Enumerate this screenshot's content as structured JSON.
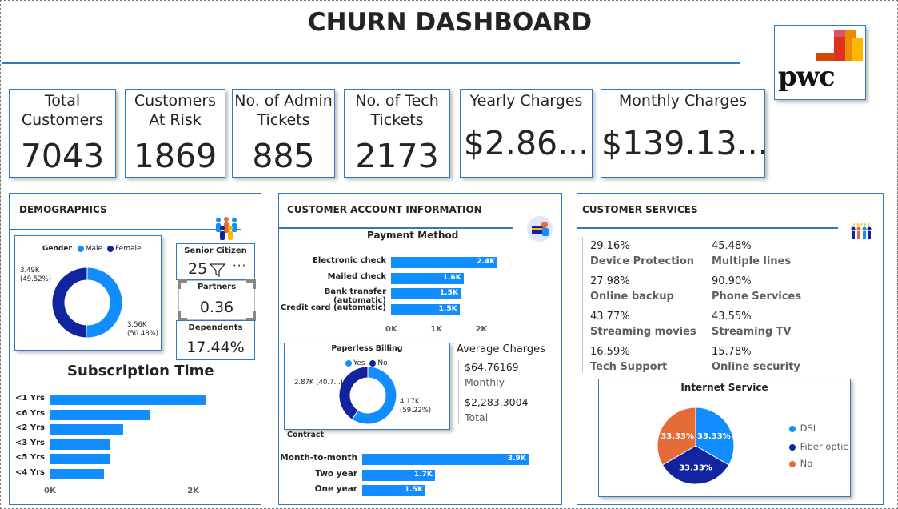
{
  "title": "CHURN DASHBOARD",
  "logo": {
    "text": "pwc"
  },
  "kpis": [
    {
      "label": "Total Customers",
      "value": "7043"
    },
    {
      "label": "Customers At Risk",
      "value": "1869"
    },
    {
      "label": "No. of Admin Tickets",
      "value": "885"
    },
    {
      "label": "No. of Tech Tickets",
      "value": "2173"
    },
    {
      "label": "Yearly Charges",
      "value": "$2.86..."
    },
    {
      "label": "Monthly Charges",
      "value": "$139.13..."
    }
  ],
  "demographics": {
    "header": "DEMOGRAPHICS",
    "icon": "people-group-icon",
    "gender_legend_title": "Gender",
    "senior_label": "Senior Citizen",
    "senior_value": "25",
    "partners_label": "Partners",
    "partners_value": "0.36",
    "dependents_label": "Dependents",
    "dependents_value": "17.44%",
    "subscription_title": "Subscription Time"
  },
  "account": {
    "header": "CUSTOMER ACCOUNT INFORMATION",
    "icon": "account-card-icon",
    "payment_title": "Payment Method",
    "paperless_title": "Paperless Billing",
    "avg_title": "Average Charges",
    "avg_monthly_value": "$64.76169",
    "avg_monthly_label": "Monthly",
    "avg_total_value": "$2,283.3004",
    "avg_total_label": "Total",
    "contract_title": "Contract"
  },
  "services": {
    "header": "CUSTOMER SERVICES",
    "icon": "team-icon",
    "items": [
      {
        "pct": "29.16%",
        "name": "Device Protection"
      },
      {
        "pct": "45.48%",
        "name": "Multiple lines"
      },
      {
        "pct": "27.98%",
        "name": "Online backup"
      },
      {
        "pct": "90.90%",
        "name": "Phone Services"
      },
      {
        "pct": "43.77%",
        "name": "Streaming movies"
      },
      {
        "pct": "43.55%",
        "name": "Streaming TV"
      },
      {
        "pct": "16.59%",
        "name": "Tech Support"
      },
      {
        "pct": "15.78%",
        "name": "Online security"
      }
    ],
    "internet_title": "Internet Service"
  },
  "colors": {
    "accent": "#118dff",
    "dark": "#12239e",
    "orange": "#e66c37",
    "border": "#2f7bbd"
  },
  "chart_data": [
    {
      "id": "gender",
      "type": "pie",
      "title": "",
      "legend_title": "Gender",
      "categories": [
        "Male",
        "Female"
      ],
      "values": [
        3.56,
        3.49
      ],
      "labels": [
        "3.56K (50.48%)",
        "3.49K (49.52%)"
      ],
      "colors": [
        "#118dff",
        "#12239e"
      ]
    },
    {
      "id": "subscription",
      "type": "bar",
      "title": "Subscription Time",
      "categories": [
        "<1 Yrs",
        "<6 Yrs",
        "<2 Yrs",
        "<3 Yrs",
        "<5 Yrs",
        "<4 Yrs"
      ],
      "values": [
        2186,
        1407,
        1024,
        832,
        832,
        762
      ],
      "xticks": [
        "0K",
        "2K"
      ],
      "xlim": [
        0,
        2700
      ]
    },
    {
      "id": "payment",
      "type": "bar",
      "title": "Payment Method",
      "categories": [
        "Electronic check",
        "Mailed check",
        "Bank transfer (automatic)",
        "Credit card (automatic)"
      ],
      "values": [
        2365,
        1612,
        1544,
        1522
      ],
      "labels": [
        "2.4K",
        "1.6K",
        "1.5K",
        "1.5K"
      ],
      "xticks": [
        "0K",
        "1K",
        "2K"
      ],
      "xlim": [
        0,
        2700
      ]
    },
    {
      "id": "paperless",
      "type": "pie",
      "title": "Paperless Billing",
      "categories": [
        "Yes",
        "No"
      ],
      "values": [
        4.17,
        2.87
      ],
      "labels": [
        "4.17K (59.22%)",
        "2.87K (40.7...)"
      ],
      "colors": [
        "#118dff",
        "#12239e"
      ]
    },
    {
      "id": "contract",
      "type": "bar",
      "title": "Contract",
      "categories": [
        "Month-to-month",
        "Two year",
        "One year"
      ],
      "values": [
        3875,
        1695,
        1473
      ],
      "labels": [
        "3.9K",
        "1.7K",
        "1.5K"
      ],
      "xlim": [
        0,
        4400
      ]
    },
    {
      "id": "internet",
      "type": "pie",
      "title": "Internet Service",
      "categories": [
        "DSL",
        "Fiber optic",
        "No"
      ],
      "values": [
        33.33,
        33.33,
        33.33
      ],
      "labels": [
        "33.33%",
        "33.33%",
        "33.33%"
      ],
      "colors": [
        "#118dff",
        "#12239e",
        "#e66c37"
      ]
    }
  ]
}
